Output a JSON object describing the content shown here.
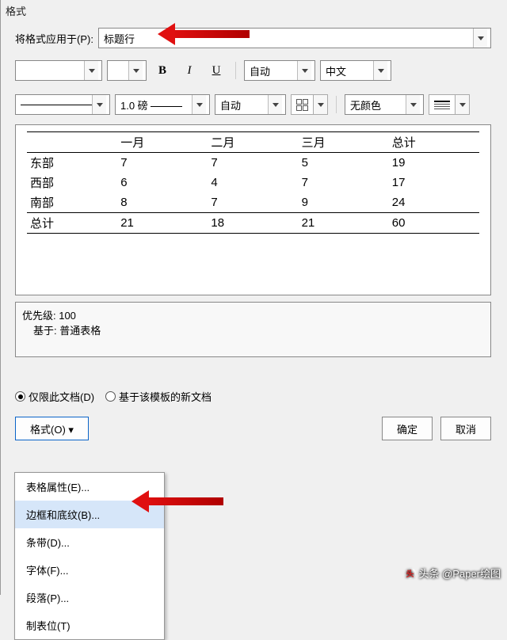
{
  "section_title": "格式",
  "apply_to": {
    "label": "将格式应用于(P):",
    "value": "标题行"
  },
  "font_row": {
    "font_family": "",
    "font_size": "",
    "auto_color": "自动",
    "lang": "中文"
  },
  "border_row": {
    "line_weight": "1.0 磅",
    "auto": "自动",
    "no_color": "无颜色"
  },
  "table": {
    "headers": [
      "",
      "一月",
      "二月",
      "三月",
      "总计"
    ],
    "rows": [
      [
        "东部",
        "7",
        "7",
        "5",
        "19"
      ],
      [
        "西部",
        "6",
        "4",
        "7",
        "17"
      ],
      [
        "南部",
        "8",
        "7",
        "9",
        "24"
      ]
    ],
    "footer": [
      "总计",
      "21",
      "18",
      "21",
      "60"
    ]
  },
  "priority": {
    "line1": "优先级: 100",
    "line2": "基于: 普通表格"
  },
  "radios": {
    "doc_only": "仅限此文档(D)",
    "template_new": "基于该模板的新文档"
  },
  "footer_btns": {
    "format": "格式(O)",
    "ok": "确定",
    "cancel": "取消"
  },
  "menu": {
    "items": [
      "表格属性(E)...",
      "边框和底纹(B)...",
      "条带(D)...",
      "字体(F)...",
      "段落(P)...",
      "制表位(T)"
    ]
  },
  "watermark": "头条 @Paper绘图",
  "chart_data": {
    "type": "table",
    "title": "",
    "columns": [
      "",
      "一月",
      "二月",
      "三月",
      "总计"
    ],
    "rows": [
      {
        "label": "东部",
        "values": [
          7,
          7,
          5,
          19
        ]
      },
      {
        "label": "西部",
        "values": [
          6,
          4,
          7,
          17
        ]
      },
      {
        "label": "南部",
        "values": [
          8,
          7,
          9,
          24
        ]
      },
      {
        "label": "总计",
        "values": [
          21,
          18,
          21,
          60
        ]
      }
    ]
  }
}
